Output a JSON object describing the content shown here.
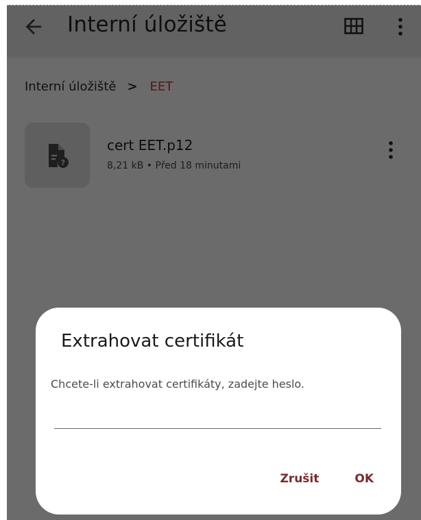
{
  "app_bar": {
    "title": "Interní úložiště",
    "back_icon": "arrow-left-icon",
    "view_icon": "grid-view-icon",
    "menu_icon": "more-vert-icon"
  },
  "breadcrumb": {
    "root": "Interní úložiště",
    "separator": ">",
    "current": "EET"
  },
  "file": {
    "name": "cert EET.p12",
    "meta": "8,21 kB • Před 18 minutami",
    "icon": "unknown-file-icon"
  },
  "dialog": {
    "title": "Extrahovat certifikát",
    "message": "Chcete-li extrahovat certifikáty, zadejte heslo.",
    "password_value": "",
    "cancel_label": "Zrušit",
    "ok_label": "OK"
  },
  "colors": {
    "scrim": "#6b6b6b",
    "dialog_bg": "#ffffff",
    "accent": "#7a2a2a"
  }
}
